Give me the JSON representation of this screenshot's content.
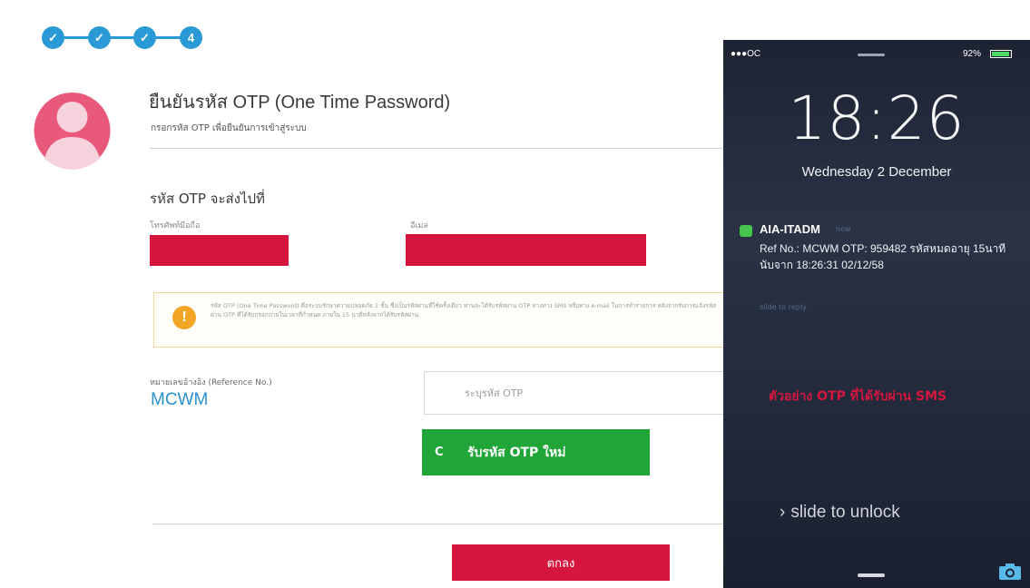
{
  "stepper": {
    "steps": [
      {
        "state": "done"
      },
      {
        "state": "done"
      },
      {
        "state": "done"
      },
      {
        "state": "current",
        "label": "4"
      }
    ],
    "accent": "#2a9ad6"
  },
  "header": {
    "title": "ยืนยันรหัส OTP (One Time Password)",
    "subtitle": "กรอกรหัส OTP เพื่อยืนยันการเข้าสู่ระบบ"
  },
  "send_to": {
    "title": "รหัส OTP จะส่งไปที่",
    "phone_label": "โทรศัพท์มือถือ",
    "email_label": "อีเมล"
  },
  "notice": {
    "text": "รหัส OTP (One Time Password) คือระบบรักษาความปลอดภัย 2 ชั้น ซึ่งเป็นรหัสผ่านที่ใช้ครั้งเดียว ท่านจะได้รับรหัสผ่าน OTP ทางทาง SMS หรือทาง e-mail ในการทำรายการ หลังจากรับการแจ้งรหัสผ่าน OTP ที่ได้รับกรอกภายในเวลาที่กำหนด ภายใน 15 นาทีหลังจากได้รับรหัสผ่าน"
  },
  "reference": {
    "label": "หมายเลขอ้างอิง (Reference No.)",
    "value": "MCWM"
  },
  "otp_input": {
    "placeholder": "ระบุรหัส OTP"
  },
  "buttons": {
    "new_otp": "รับรหัส OTP ใหม่",
    "ok": "ตกลง"
  },
  "colors": {
    "brand_red": "#d6163f",
    "green": "#20a538",
    "link_blue": "#2a8fd1"
  },
  "phone": {
    "carrier": "●●●OC",
    "battery": "92%",
    "time": "18:26",
    "date": "Wednesday 2 December",
    "notification": {
      "app": "AIA-ITADM",
      "when": "now",
      "body": "Ref No.: MCWM OTP: 959482 รหัสหมดอายุ 15นาที นับจาก 18:26:31 02/12/58",
      "reply": "slide to reply"
    },
    "sample_caption": "ตัวอย่าง OTP ที่ได้รับผ่าน SMS",
    "slide_to_unlock": "slide to unlock"
  }
}
